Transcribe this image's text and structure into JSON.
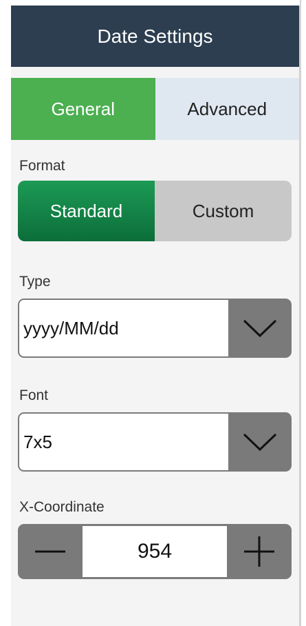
{
  "header": {
    "title": "Date Settings"
  },
  "tabs": [
    {
      "label": "General",
      "active": true
    },
    {
      "label": "Advanced",
      "active": false
    }
  ],
  "format": {
    "label": "Format",
    "options": [
      {
        "label": "Standard",
        "selected": true
      },
      {
        "label": "Custom",
        "selected": false
      }
    ]
  },
  "type": {
    "label": "Type",
    "value": "yyyy/MM/dd",
    "icon": "chevron-down-icon"
  },
  "font": {
    "label": "Font",
    "value": "7x5",
    "icon": "chevron-down-icon"
  },
  "x_coordinate": {
    "label": "X-Coordinate",
    "value": "954",
    "decrement_icon": "minus-icon",
    "increment_icon": "plus-icon"
  },
  "colors": {
    "header_bg": "#2c3e50",
    "tab_active": "#4caf50",
    "tab_inactive": "#dfe8f1",
    "segment_active": "#1a8a4a",
    "segment_inactive": "#c8c8c8",
    "control_gray": "#7a7a7a"
  }
}
